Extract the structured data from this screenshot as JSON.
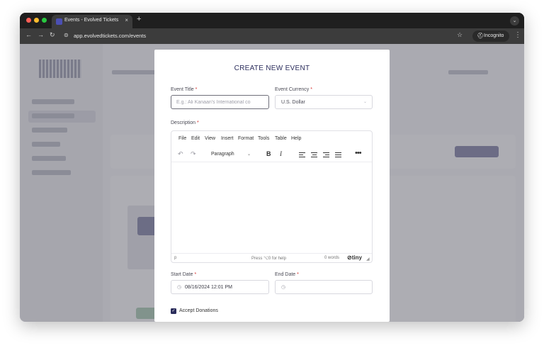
{
  "browser": {
    "tab_title": "Events - Evolved Tickets",
    "tab_close": "×",
    "new_tab": "+",
    "tab_dropdown": "⌄",
    "url": "app.evolvedtickets.com/events",
    "incognito_label": "Incognito",
    "icons": {
      "back": "←",
      "forward": "→",
      "reload": "↻",
      "site_settings": "⊜",
      "star": "☆",
      "incognito": "⛑",
      "menu": "⋮"
    },
    "traffic_lights": [
      "#ff5f57",
      "#febc2e",
      "#28c840"
    ]
  },
  "modal": {
    "title": "CREATE NEW EVENT",
    "event_title": {
      "label": "Event Title",
      "required": "*",
      "placeholder": "E.g.: Ali Kanaan's International co"
    },
    "event_currency": {
      "label": "Event Currency",
      "required": "*",
      "value": "U.S. Dollar",
      "chevron": "⌄"
    },
    "description": {
      "label": "Description",
      "required": "*"
    },
    "editor": {
      "menu": [
        "File",
        "Edit",
        "View",
        "Insert",
        "Format",
        "Tools",
        "Table",
        "Help"
      ],
      "undo": "↶",
      "redo": "↷",
      "block_format": "Paragraph",
      "block_chevron": "⌄",
      "bold": "B",
      "italic": "I",
      "more": "•••",
      "status_path": "p",
      "help_hint": "Press ⌥0 for help",
      "word_count": "0 words",
      "brand": "tiny",
      "brand_icon": "⊘",
      "resize_handle": "◢"
    },
    "start_date": {
      "label": "Start Date",
      "required": "*",
      "value": "08/16/2024 12:01 PM",
      "icon": "◷"
    },
    "end_date": {
      "label": "End Date",
      "required": "*",
      "value": "",
      "icon": "◷"
    },
    "accept_donations": {
      "label": "Accept Donations",
      "checked": true,
      "check_glyph": "✓"
    }
  },
  "colors": {
    "accent": "#2b2d5c",
    "required": "#d6322f"
  }
}
